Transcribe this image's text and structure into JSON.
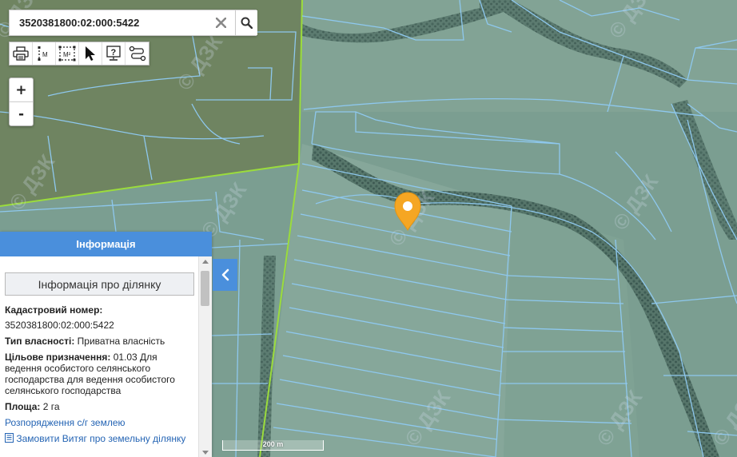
{
  "search": {
    "value": "3520381800:02:000:5422",
    "clear_icon": "close-icon",
    "search_icon": "search-icon"
  },
  "toolbar": {
    "tools": [
      {
        "name": "print-tool",
        "icon": "printer-icon"
      },
      {
        "name": "measure-distance-tool",
        "icon": "ruler-icon",
        "label": "M"
      },
      {
        "name": "measure-area-tool",
        "icon": "area-icon",
        "label": "M²"
      },
      {
        "name": "select-tool",
        "icon": "cursor-icon"
      },
      {
        "name": "info-tool",
        "icon": "question-icon",
        "label": "?"
      },
      {
        "name": "route-tool",
        "icon": "route-icon"
      }
    ]
  },
  "zoom": {
    "in_label": "+",
    "out_label": "-"
  },
  "info_panel": {
    "header": "Інформація",
    "subheader": "Інформація про ділянку",
    "cadastral_label": "Кадастровий номер:",
    "cadastral_value": "3520381800:02:000:5422",
    "ownership_label": "Тип власності:",
    "ownership_value": "Приватна власність",
    "purpose_label": "Цільове призначення:",
    "purpose_value": "01.03 Для ведення особистого селянського господарства для ведення особистого селянського господарства",
    "area_label": "Площа:",
    "area_value": "2 га",
    "link_orders": "Розпорядження с/г землею",
    "link_extract": "Замовити Витяг про земельну ділянку",
    "extract_icon": "document-icon"
  },
  "map": {
    "scale_label": "200 m",
    "watermark": "© ДЗК",
    "marker_icon": "map-pin-icon",
    "colors": {
      "parcel_line": "#8ec8ee",
      "boundary_line": "#9bdc3c",
      "marker": "#f5a623",
      "panel_header": "#4a8fdc",
      "link": "#2464b4"
    }
  }
}
